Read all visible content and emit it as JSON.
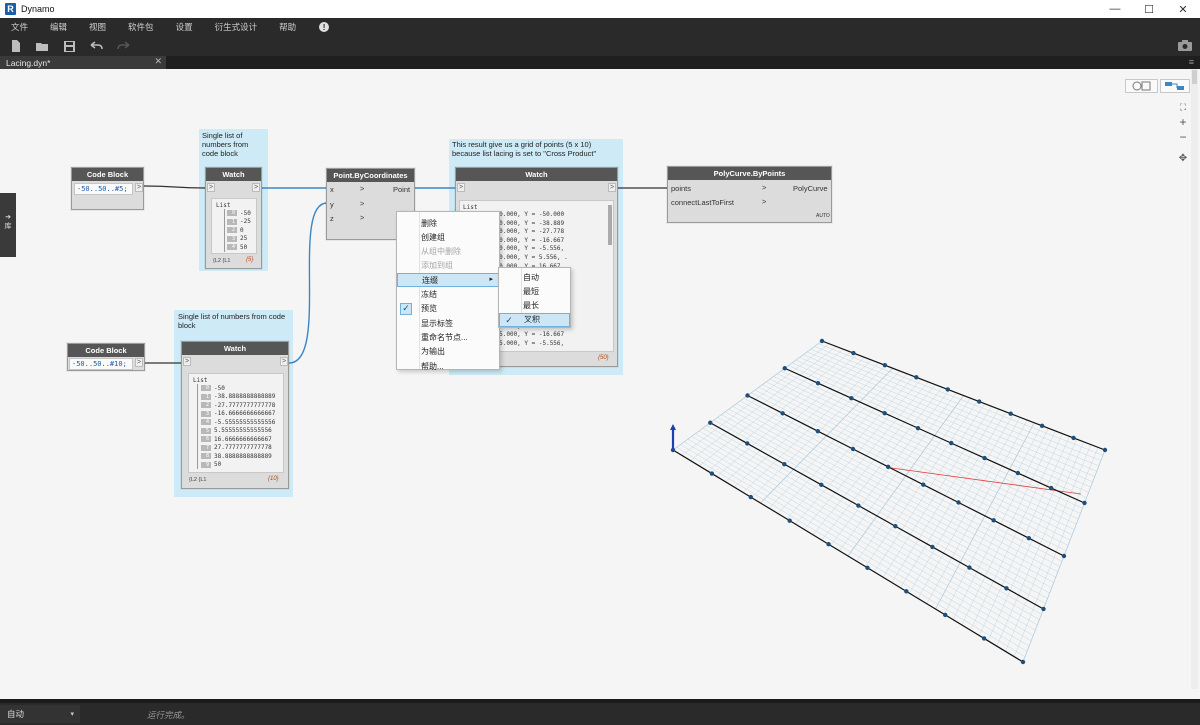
{
  "window": {
    "app_logo": "R",
    "title": "Dynamo",
    "controls": [
      "—",
      "☐",
      "✕"
    ]
  },
  "menu": [
    "文件",
    "编辑",
    "视图",
    "软件包",
    "设置",
    "衍生式设计",
    "帮助"
  ],
  "menu_alert": "!",
  "toolbar": {
    "buttons": [
      "new-file-icon",
      "open-folder-icon",
      "save-icon",
      "undo-icon",
      "redo-icon"
    ],
    "camera": "camera-icon"
  },
  "tab": {
    "label": "Lacing.dyn*",
    "close": "✕",
    "menu": "≡"
  },
  "side_handle": {
    "arrow": "➔",
    "label": "库"
  },
  "notes": {
    "watch1": [
      "Single list of",
      "numbers from",
      "code block"
    ],
    "watch2": [
      "Single list of numbers from code",
      "block"
    ],
    "result": [
      "This result give us a grid of points (5 x 10)",
      "because list lacing is set to \"Cross Product\""
    ]
  },
  "nodes": {
    "code1": {
      "title": "Code Block",
      "code": "-50..50..#5;",
      "out": ">"
    },
    "code2": {
      "title": "Code Block",
      "code": "-50..50..#10;",
      "out": ">"
    },
    "watch1": {
      "title": "Watch",
      "in": ">",
      "out": ">",
      "list": "List",
      "items": [
        [
          "0",
          "-50"
        ],
        [
          "1",
          "-25"
        ],
        [
          "2",
          "0"
        ],
        [
          "3",
          "25"
        ],
        [
          "4",
          "50"
        ]
      ],
      "foot": "{L2 {L1",
      "count": "{5}"
    },
    "watch2": {
      "title": "Watch",
      "in": ">",
      "out": ">",
      "list": "List",
      "items": [
        [
          "0",
          "-50"
        ],
        [
          "1",
          "-38.8888888888889"
        ],
        [
          "2",
          "-27.7777777777778"
        ],
        [
          "3",
          "-16.6666666666667"
        ],
        [
          "4",
          "-5.55555555555556"
        ],
        [
          "5",
          "5.55555555555556"
        ],
        [
          "6",
          "16.6666666666667"
        ],
        [
          "7",
          "27.7777777777778"
        ],
        [
          "8",
          "38.8888888888889"
        ],
        [
          "9",
          "50"
        ]
      ],
      "foot": "{L2 {L1",
      "count": "{10}"
    },
    "point": {
      "title": "Point.ByCoordinates",
      "inputs": [
        "x",
        "y",
        "z"
      ],
      "output": "Point",
      "arrow": ">"
    },
    "watch3": {
      "title": "Watch",
      "in": ">",
      "out": ">",
      "list": "List",
      "lines": [
        "int(X = -50.000, Y = -50.000",
        "int(X = -50.000, Y = -38.889",
        "int(X = -50.000, Y = -27.778",
        "int(X = -50.000, Y = -16.667",
        "int(X = -50.000, Y = -5.556,",
        "int(X = -50.000, Y = 5.556, .",
        "int(X = -50.000, Y = 16.667,",
        "int(X = -50.000, Y = 27.778,",
        "int(X = -50.000, Y = 38.889,",
        "int(X = -50.000, Y = 50.000,",
        "",
        "int(X = -25.000, Y = -50.000",
        "int(X = -25.000, Y = -38.889",
        "int(X = -25.000, Y = -27.778",
        "int(X = -25.000, Y = -16.667",
        "int(X = -25.000, Y = -5.556,"
      ],
      "count": "{50}"
    },
    "polycurve": {
      "title": "PolyCurve.ByPoints",
      "inputs": [
        "points",
        "connectLastToFirst"
      ],
      "output": "PolyCurve",
      "arrow": ">",
      "badge": "AUTO"
    }
  },
  "context_menu": {
    "items": [
      {
        "label": "删除",
        "state": "normal"
      },
      {
        "label": "创建组",
        "state": "normal"
      },
      {
        "label": "从组中删除",
        "state": "disabled"
      },
      {
        "label": "添加到组",
        "state": "disabled"
      },
      {
        "label": "连缀",
        "state": "highlight",
        "submenu": "▸"
      },
      {
        "label": "冻结",
        "state": "normal"
      },
      {
        "label": "预览",
        "state": "checked"
      },
      {
        "label": "显示标签",
        "state": "normal"
      },
      {
        "label": "重命名节点...",
        "state": "normal"
      },
      {
        "label": "为输出",
        "state": "normal"
      },
      {
        "label": "帮助...",
        "state": "normal"
      }
    ],
    "check_mark": "✓"
  },
  "lacing_submenu": {
    "items": [
      {
        "label": "自动",
        "checked": false
      },
      {
        "label": "最短",
        "checked": false
      },
      {
        "label": "最长",
        "checked": false
      },
      {
        "label": "叉积",
        "checked": true
      }
    ],
    "check_mark": "✓"
  },
  "zoom_controls": [
    "⛶",
    "+",
    "−",
    "✥"
  ],
  "status": {
    "run_mode": "自动",
    "caret": "▾",
    "message": "运行完成。"
  },
  "colors": {
    "wire": "#3d86c4",
    "node_header": "#565656",
    "note": "#cdeaf6",
    "grid_line": "#a9c8dc",
    "polycurve": "#111111",
    "point": "#1d4f7a",
    "x_axis": "#e04040"
  }
}
